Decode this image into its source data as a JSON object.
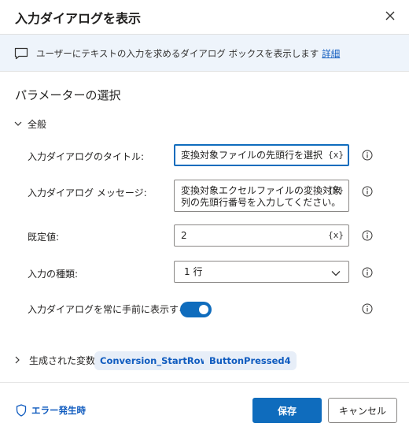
{
  "dialog": {
    "title": "入力ダイアログを表示",
    "description": "ユーザーにテキストの入力を求めるダイアログ ボックスを表示します",
    "details_link": "詳細"
  },
  "parameters": {
    "section_title": "パラメーターの選択",
    "group_label": "全般",
    "fields": {
      "title": {
        "label": "入力ダイアログのタイトル:",
        "value": "変換対象ファイルの先頭行を選択",
        "var_button": "{x}"
      },
      "message": {
        "label": "入力ダイアログ メッセージ:",
        "value_line1": "変換対象エクセルファイルの変換対象",
        "value_line2": "列の先頭行番号を入力してください。",
        "var_button": "{x}"
      },
      "default": {
        "label": "既定値:",
        "value": "2",
        "var_button": "{x}"
      },
      "input_type": {
        "label": "入力の種類:",
        "value": "1 行"
      },
      "topmost": {
        "label": "入力ダイアログを常に手前に表示する:",
        "enabled": true
      }
    }
  },
  "variables": {
    "label": "生成された変数",
    "items": [
      "Conversion_StartRow",
      "ButtonPressed4"
    ]
  },
  "footer": {
    "on_error": "エラー発生時",
    "save": "保存",
    "cancel": "キャンセル"
  },
  "colors": {
    "accent": "#0f6cbd",
    "banner_bg": "#eef4fb",
    "link": "#0f5bbf"
  }
}
